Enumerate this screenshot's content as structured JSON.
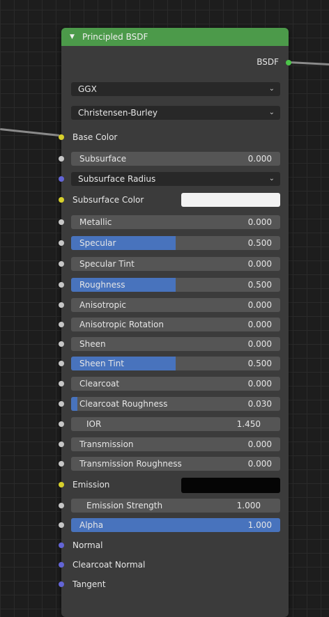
{
  "node": {
    "title": "Principled BSDF",
    "output_label": "BSDF",
    "distribution": "GGX",
    "subsurface_method": "Christensen-Burley",
    "colors": {
      "header": "#4c9a4a",
      "accent": "#4873bd",
      "subsurface_color": "#f2f2f2",
      "emission_color": "#050505"
    }
  },
  "inputs": {
    "base_color": "Base Color",
    "subsurface": {
      "label": "Subsurface",
      "value": "0.000",
      "fraction": 0
    },
    "subsurface_radius": "Subsurface Radius",
    "subsurface_color": "Subsurface Color",
    "metallic": {
      "label": "Metallic",
      "value": "0.000",
      "fraction": 0
    },
    "specular": {
      "label": "Specular",
      "value": "0.500",
      "fraction": 0.5
    },
    "specular_tint": {
      "label": "Specular Tint",
      "value": "0.000",
      "fraction": 0
    },
    "roughness": {
      "label": "Roughness",
      "value": "0.500",
      "fraction": 0.5
    },
    "anisotropic": {
      "label": "Anisotropic",
      "value": "0.000",
      "fraction": 0
    },
    "anisotropic_rotation": {
      "label": "Anisotropic Rotation",
      "value": "0.000",
      "fraction": 0
    },
    "sheen": {
      "label": "Sheen",
      "value": "0.000",
      "fraction": 0
    },
    "sheen_tint": {
      "label": "Sheen Tint",
      "value": "0.500",
      "fraction": 0.5
    },
    "clearcoat": {
      "label": "Clearcoat",
      "value": "0.000",
      "fraction": 0
    },
    "clearcoat_roughness": {
      "label": "Clearcoat Roughness",
      "value": "0.030",
      "fraction": 0.03
    },
    "ior": {
      "label": "IOR",
      "value": "1.450"
    },
    "transmission": {
      "label": "Transmission",
      "value": "0.000",
      "fraction": 0
    },
    "transmission_roughness": {
      "label": "Transmission Roughness",
      "value": "0.000",
      "fraction": 0
    },
    "emission": "Emission",
    "emission_strength": {
      "label": "Emission Strength",
      "value": "1.000"
    },
    "alpha": {
      "label": "Alpha",
      "value": "1.000",
      "fraction": 1
    },
    "normal": "Normal",
    "clearcoat_normal": "Clearcoat Normal",
    "tangent": "Tangent"
  }
}
